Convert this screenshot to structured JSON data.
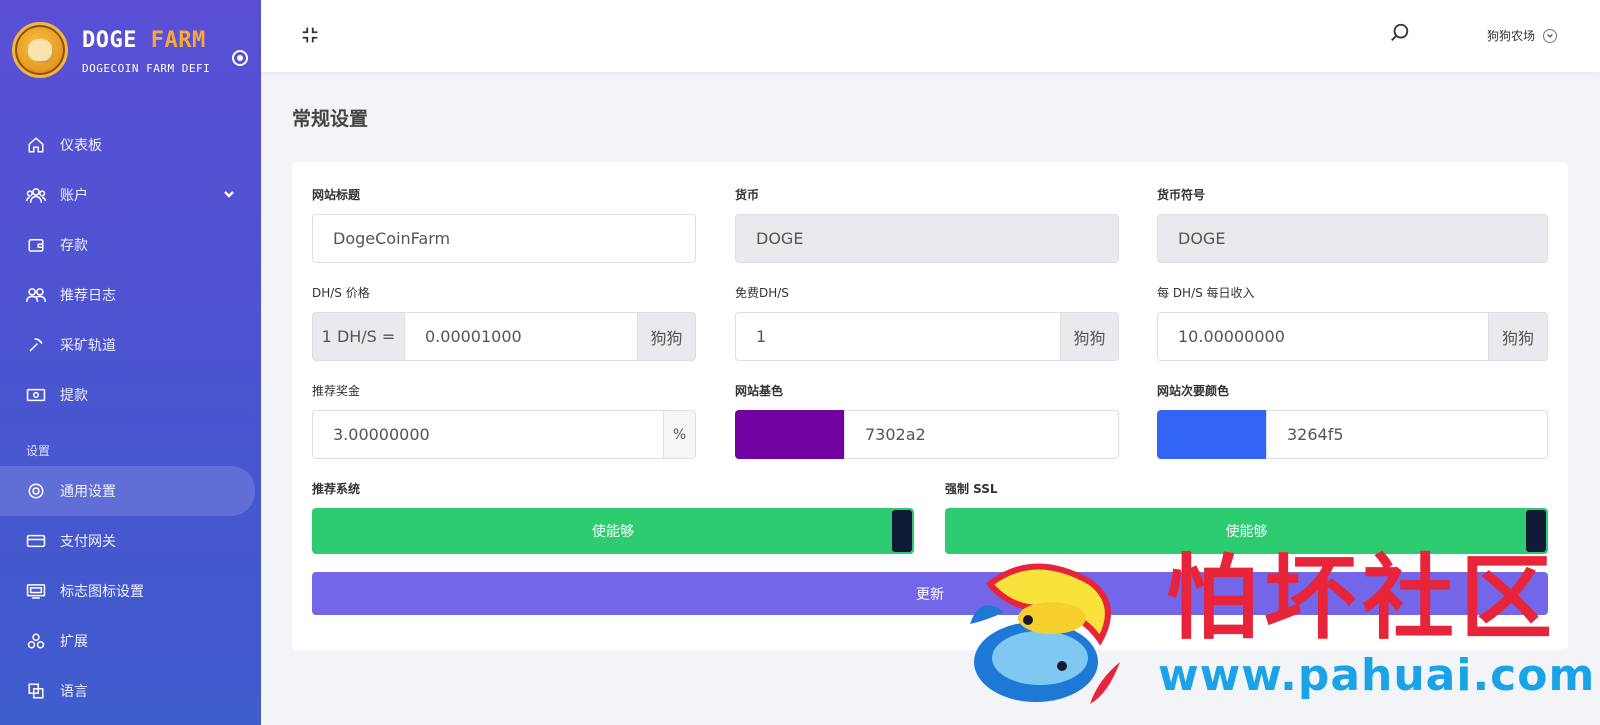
{
  "brand": {
    "name_part1": "DOGE",
    "name_part2": "FARM",
    "subtitle": "DOGECOIN FARM DEFI"
  },
  "sidebar": {
    "items": [
      {
        "label": "仪表板",
        "icon": "home-icon"
      },
      {
        "label": "账户",
        "icon": "users-icon"
      },
      {
        "label": "存款",
        "icon": "wallet-icon"
      },
      {
        "label": "推荐日志",
        "icon": "referral-icon"
      },
      {
        "label": "采矿轨道",
        "icon": "pickaxe-icon"
      },
      {
        "label": "提款",
        "icon": "cash-icon"
      }
    ],
    "section_label": "设置",
    "settings_items": [
      {
        "label": "通用设置",
        "icon": "lifebuoy-icon",
        "active": true
      },
      {
        "label": "支付网关",
        "icon": "card-icon"
      },
      {
        "label": "标志图标设置",
        "icon": "image-icon"
      },
      {
        "label": "扩展",
        "icon": "puzzle-icon"
      },
      {
        "label": "语言",
        "icon": "translate-icon"
      }
    ]
  },
  "header": {
    "user_menu": "狗狗农场"
  },
  "page": {
    "title": "常规设置"
  },
  "form": {
    "site_title": {
      "label": "网站标题",
      "value": "DogeCoinFarm"
    },
    "currency": {
      "label": "货币",
      "value": "DOGE"
    },
    "currency_symbol": {
      "label": "货币符号",
      "value": "DOGE"
    },
    "dhs_price": {
      "label": "DH/S 价格",
      "prefix": "1 DH/S =",
      "value": "0.00001000",
      "suffix": "狗狗"
    },
    "free_dhs": {
      "label": "免费DH/S",
      "value": "1",
      "suffix": "狗狗"
    },
    "daily_income": {
      "label": "每 DH/S 每日收入",
      "value": "10.00000000",
      "suffix": "狗狗"
    },
    "referral_bonus": {
      "label": "推荐奖金",
      "value": "3.00000000",
      "suffix": "%"
    },
    "base_color": {
      "label": "网站基色",
      "value": "7302a2",
      "color": "#7302a2"
    },
    "secondary_color": {
      "label": "网站次要颜色",
      "value": "3264f5",
      "color": "#3264f5"
    },
    "referral_system": {
      "label": "推荐系统",
      "state": "使能够"
    },
    "force_ssl": {
      "label": "强制 SSL",
      "state": "使能够"
    },
    "submit_label": "更新"
  },
  "watermark": {
    "title": "怕坏社区",
    "url": "www.pahuai.com"
  },
  "colors": {
    "sidebar": "#5a4fd6",
    "toggle_on": "#2ecc71",
    "update_button": "#7366e8",
    "watermark_red": "#e8243b",
    "watermark_blue": "#1aa3e6"
  }
}
